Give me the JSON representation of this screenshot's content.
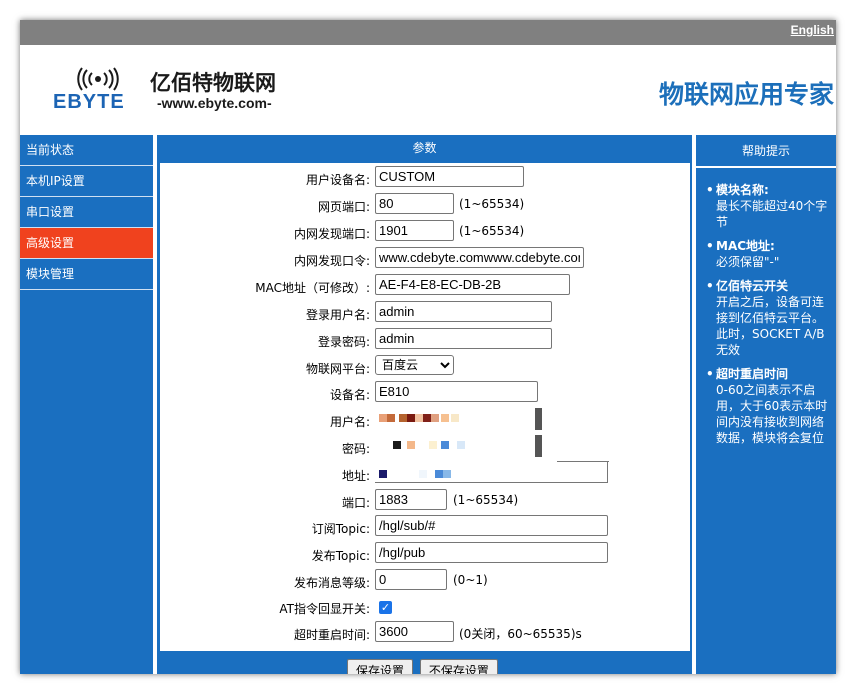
{
  "topbar": {
    "language_link": "English"
  },
  "header": {
    "brand_name": "亿佰特物联网",
    "brand_url": "-www.ebyte.com-",
    "brand_logo_text": "EBYTE",
    "slogan": "物联网应用专家"
  },
  "sidebar": {
    "items": [
      {
        "label": "当前状态",
        "active": false
      },
      {
        "label": "本机IP设置",
        "active": false
      },
      {
        "label": "串口设置",
        "active": false
      },
      {
        "label": "高级设置",
        "active": true
      },
      {
        "label": "模块管理",
        "active": false
      }
    ]
  },
  "main": {
    "title": "参数",
    "fields": {
      "device_name": {
        "label": "用户设备名:",
        "value": "CUSTOM"
      },
      "web_port": {
        "label": "网页端口:",
        "value": "80",
        "hint": "(1~65534)"
      },
      "lan_port": {
        "label": "内网发现端口:",
        "value": "1901",
        "hint": "(1~65534)"
      },
      "lan_password": {
        "label": "内网发现口令:",
        "value": "www.cdebyte.comwww.cdebyte.com"
      },
      "mac": {
        "label": "MAC地址（可修改）:",
        "value": "AE-F4-E8-EC-DB-2B"
      },
      "login_user": {
        "label": "登录用户名:",
        "value": "admin"
      },
      "login_pass": {
        "label": "登录密码:",
        "value": "admin"
      },
      "platform": {
        "label": "物联网平台:",
        "value": "百度云"
      },
      "iot_device_name": {
        "label": "设备名:",
        "value": "E810"
      },
      "iot_user": {
        "label": "用户名:"
      },
      "iot_pass": {
        "label": "密码:"
      },
      "iot_addr": {
        "label": "地址:"
      },
      "iot_port": {
        "label": "端口:",
        "value": "1883",
        "hint": "(1~65534)"
      },
      "sub_topic": {
        "label": "订阅Topic:",
        "value": "/hgl/sub/#"
      },
      "pub_topic": {
        "label": "发布Topic:",
        "value": "/hgl/pub"
      },
      "qos": {
        "label": "发布消息等级:",
        "value": "0",
        "hint": "(0~1)"
      },
      "at_echo": {
        "label": "AT指令回显开关:",
        "checked": true
      },
      "timeout_restart": {
        "label": "超时重启时间:",
        "value": "3600",
        "hint": "(0关闭，60~65535)s"
      }
    },
    "buttons": {
      "save": "保存设置",
      "cancel": "不保存设置"
    }
  },
  "help": {
    "title": "帮助提示",
    "items": [
      {
        "title": "模块名称:",
        "text": "最长不能超过40个字节"
      },
      {
        "title": "MAC地址:",
        "text": "必须保留\"-\""
      },
      {
        "title": "亿佰特云开关",
        "text": "开启之后，设备可连接到亿佰特云平台。此时，SOCKET A/B无效"
      },
      {
        "title": "超时重启时间",
        "text": "0-60之间表示不启用，大于60表示本时间内没有接收到网络数据，模块将会复位"
      }
    ]
  },
  "colors": {
    "primary": "#1a6fc0",
    "active": "#f0421e",
    "topbar": "#808080",
    "slogan": "#1c6fba"
  }
}
